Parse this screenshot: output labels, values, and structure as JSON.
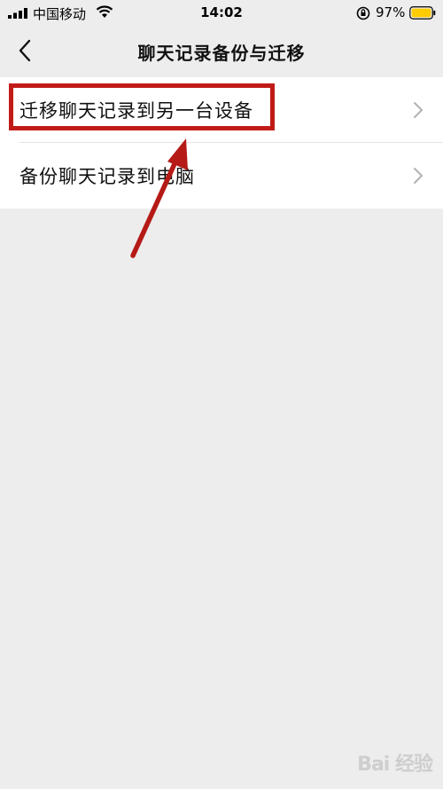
{
  "status_bar": {
    "carrier": "中国移动",
    "time": "14:02",
    "battery": "97%",
    "battery_color": "#ffcc00"
  },
  "nav": {
    "title": "聊天记录备份与迁移",
    "back_icon": "chevron-left-icon"
  },
  "list": {
    "items": [
      {
        "label": "迁移聊天记录到另一台设备",
        "icon": "chevron-right-icon"
      },
      {
        "label": "备份聊天记录到电脑",
        "icon": "chevron-right-icon"
      }
    ]
  },
  "annotation": {
    "color": "#c11b17"
  },
  "watermark": {
    "text": "Bai 经验"
  }
}
